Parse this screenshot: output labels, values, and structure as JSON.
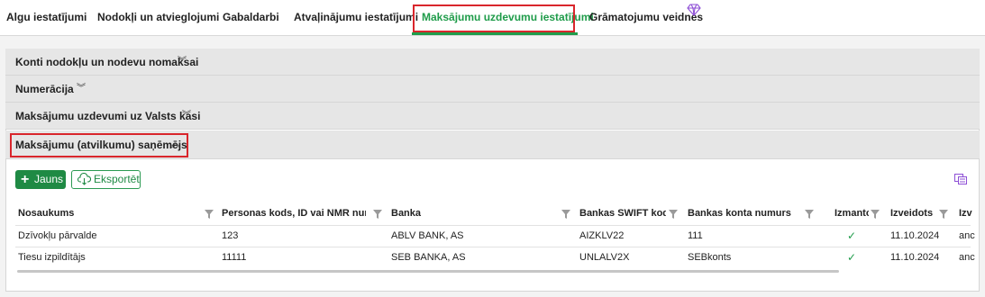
{
  "tabs": [
    {
      "label": "Algu iestatījumi"
    },
    {
      "label": "Nodokļi un atvieglojumi"
    },
    {
      "label": "Gabaldarbi"
    },
    {
      "label": "Atvaļinājumu iestatījumi"
    },
    {
      "label": "Maksājumu uzdevumu iestatījumi"
    },
    {
      "label": "Grāmatojumu veidnes"
    }
  ],
  "sections": [
    {
      "label": "Konti nodokļu un nodevu nomaksai",
      "expanded": false
    },
    {
      "label": "Numerācija",
      "expanded": false
    },
    {
      "label": "Maksājumu uzdevumi uz Valsts kasi",
      "expanded": false
    },
    {
      "label": "Maksājumu (atvilkumu) saņēmējs",
      "expanded": true
    }
  ],
  "toolbar": {
    "new_label": "Jauns",
    "export_label": "Eksportēt"
  },
  "table": {
    "columns": [
      "Nosaukums",
      "Personas kods, ID vai NMR numurs",
      "Banka",
      "Bankas SWIFT kods",
      "Bankas konta numurs",
      "Izmantot",
      "Izveidots",
      "Izv"
    ],
    "rows": [
      {
        "name": "Dzīvokļu pārvalde",
        "code": "123",
        "bank": "ABLV BANK, AS",
        "swift": "AIZKLV22",
        "account": "111",
        "created": "11.10.2024",
        "creator": "anc"
      },
      {
        "name": "Tiesu izpildītājs",
        "code": "11111",
        "bank": "SEB BANKA, AS",
        "swift": "UNLALV2X",
        "account": "SEBkonts",
        "created": "11.10.2024",
        "creator": "anc"
      }
    ]
  },
  "colors": {
    "accent": "#1f9c4a",
    "highlight": "#d9262c"
  }
}
